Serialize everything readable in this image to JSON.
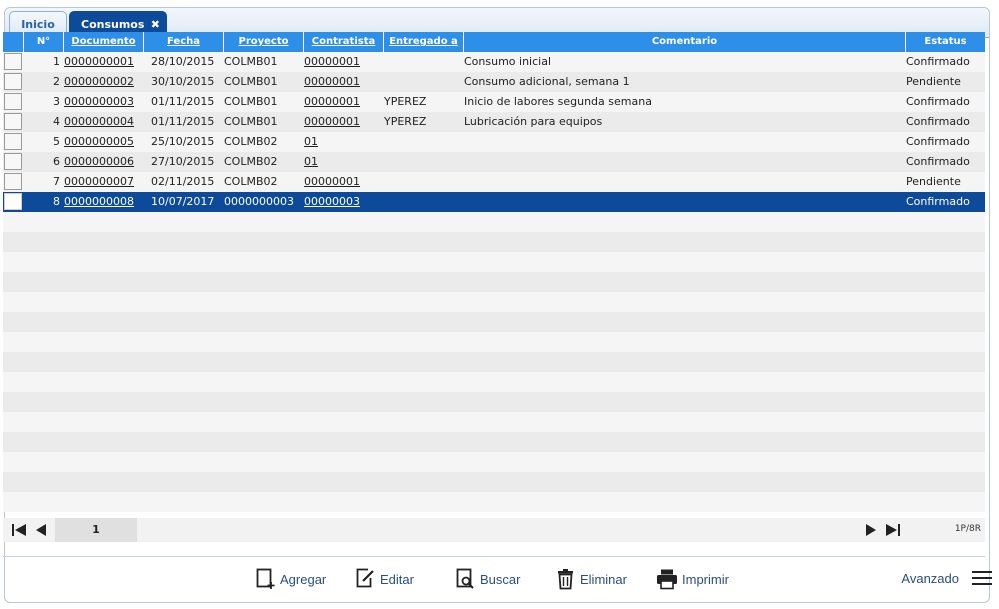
{
  "tabs": {
    "inicio": "Inicio",
    "consumos": "Consumos",
    "close_glyph": "✖"
  },
  "table": {
    "headers": {
      "num": "N°",
      "documento": "Documento",
      "fecha": "Fecha",
      "proyecto": "Proyecto",
      "contratista": "Contratista",
      "entregado": "Entregado a",
      "comentario": "Comentario",
      "estatus": "Estatus"
    },
    "rows": [
      {
        "n": "1",
        "documento": "0000000001",
        "fecha": "28/10/2015",
        "proyecto": "COLMB01",
        "contratista": "00000001",
        "entregado": "",
        "comentario": "Consumo inicial",
        "estatus": "Confirmado"
      },
      {
        "n": "2",
        "documento": "0000000002",
        "fecha": "30/10/2015",
        "proyecto": "COLMB01",
        "contratista": "00000001",
        "entregado": "",
        "comentario": "Consumo adicional, semana 1",
        "estatus": "Pendiente"
      },
      {
        "n": "3",
        "documento": "0000000003",
        "fecha": "01/11/2015",
        "proyecto": "COLMB01",
        "contratista": "00000001",
        "entregado": "YPEREZ",
        "comentario": "Inicio de labores segunda semana",
        "estatus": "Confirmado"
      },
      {
        "n": "4",
        "documento": "0000000004",
        "fecha": "01/11/2015",
        "proyecto": "COLMB01",
        "contratista": "00000001",
        "entregado": "YPEREZ",
        "comentario": "Lubricación para equipos",
        "estatus": "Confirmado"
      },
      {
        "n": "5",
        "documento": "0000000005",
        "fecha": "25/10/2015",
        "proyecto": "COLMB02",
        "contratista": "01",
        "entregado": "",
        "comentario": "",
        "estatus": "Confirmado"
      },
      {
        "n": "6",
        "documento": "0000000006",
        "fecha": "27/10/2015",
        "proyecto": "COLMB02",
        "contratista": "01",
        "entregado": "",
        "comentario": "",
        "estatus": "Confirmado"
      },
      {
        "n": "7",
        "documento": "0000000007",
        "fecha": "02/11/2015",
        "proyecto": "COLMB02",
        "contratista": "00000001",
        "entregado": "",
        "comentario": "",
        "estatus": "Pendiente"
      },
      {
        "n": "8",
        "documento": "0000000008",
        "fecha": "10/07/2017",
        "proyecto": "0000000003",
        "contratista": "00000003",
        "entregado": "",
        "comentario": "",
        "estatus": "Confirmado",
        "selected": true
      }
    ]
  },
  "pager": {
    "current_page": "1",
    "page_count": "1P/8R",
    "icons": [
      "first-page-icon",
      "prev-page-icon",
      "next-page-icon",
      "last-page-icon"
    ]
  },
  "toolbar": {
    "agregar": "Agregar",
    "editar": "Editar",
    "buscar": "Buscar",
    "eliminar": "Eliminar",
    "imprimir": "Imprimir",
    "avanzado": "Avanzado"
  },
  "colors": {
    "header_bg": "#2e8fe8",
    "selected_row": "#0d4a9a",
    "active_tab": "#0d4a9a",
    "toolbar_text": "#2a4f7a"
  }
}
